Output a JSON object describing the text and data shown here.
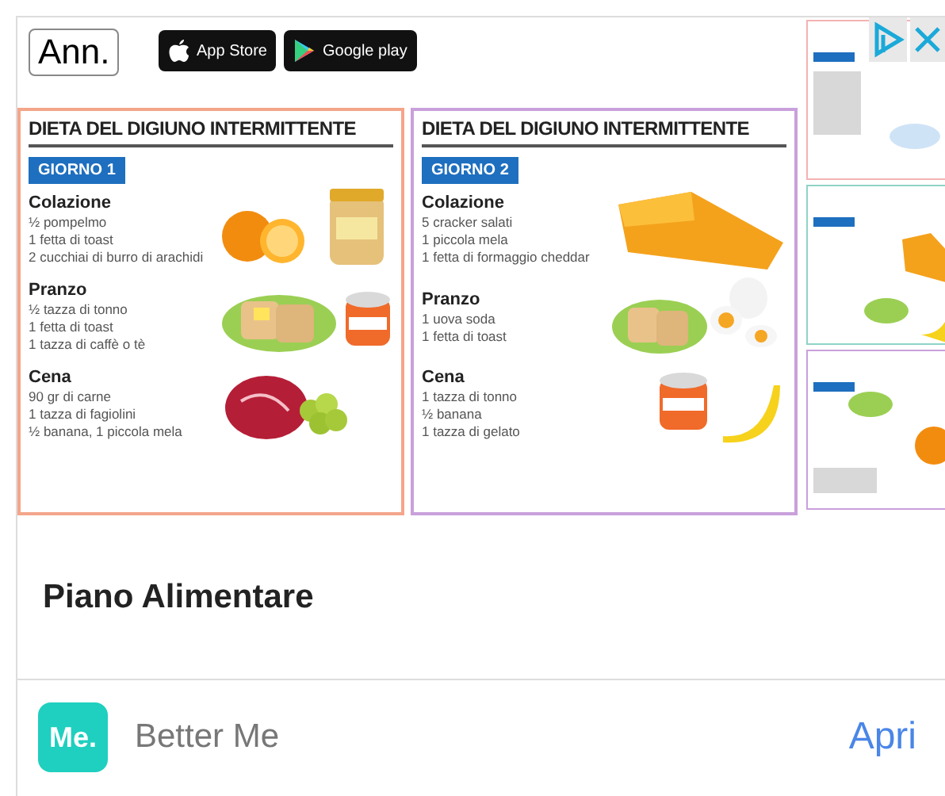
{
  "ad_label": "Ann.",
  "store_badges": [
    {
      "kind": "apple",
      "label": "App Store"
    },
    {
      "kind": "google",
      "label": "Google play"
    }
  ],
  "cards": [
    {
      "title": "DIETA DEL DIGIUNO INTERMITTENTE",
      "day": "GIORNO 1",
      "color": "#f4a58a",
      "meals": [
        {
          "name": "Colazione",
          "items": [
            "½ pompelmo",
            "1 fetta di toast",
            "2 cucchiai di burro di arachidi"
          ]
        },
        {
          "name": "Pranzo",
          "items": [
            "½ tazza di tonno",
            "1 fetta di toast",
            "1 tazza di caffè o tè"
          ]
        },
        {
          "name": "Cena",
          "items": [
            "90 gr di carne",
            "1 tazza di fagiolini",
            "½ banana, 1 piccola mela"
          ]
        }
      ]
    },
    {
      "title": "DIETA DEL DIGIUNO INTERMITTENTE",
      "day": "GIORNO 2",
      "color": "#c9a0dc",
      "meals": [
        {
          "name": "Colazione",
          "items": [
            "5 cracker salati",
            "1 piccola mela",
            "1 fetta di formaggio cheddar"
          ]
        },
        {
          "name": "Pranzo",
          "items": [
            "1 uova soda",
            "1 fetta di toast"
          ]
        },
        {
          "name": "Cena",
          "items": [
            "1 tazza di tonno",
            "½ banana",
            "1 tazza di gelato"
          ]
        }
      ]
    }
  ],
  "title": "Piano Alimentare",
  "advertiser": {
    "logo": "Me.",
    "name": "Better Me"
  },
  "cta": "Apri"
}
